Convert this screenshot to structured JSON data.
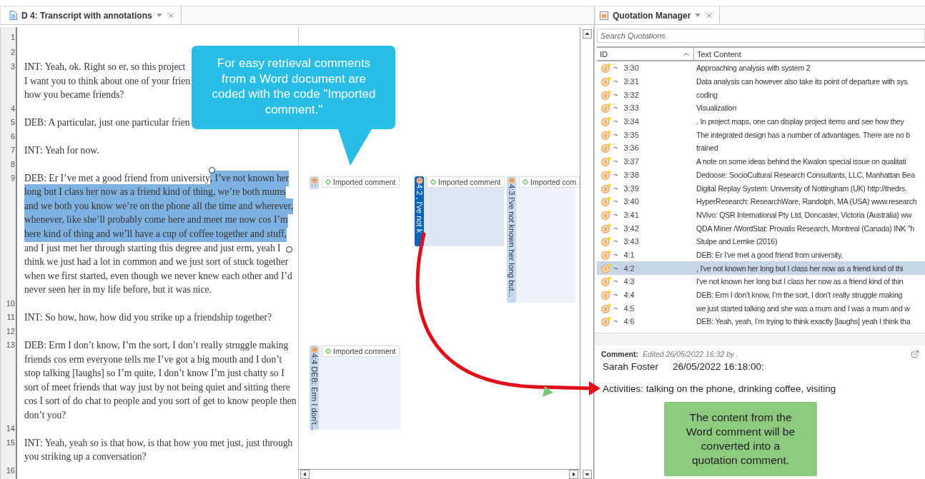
{
  "document_tab": {
    "title": "D 4: Transcript with annotations"
  },
  "transcript": [
    {
      "number": "1"
    },
    {
      "number": "2"
    },
    {
      "number": "3",
      "lines": [
        "INT: Yeah, ok. Right so er, so this project",
        "I want you to think about one of your frien",
        "how you became friends?"
      ]
    },
    {
      "number": "4"
    },
    {
      "number": "5",
      "lines": [
        "DEB: A particular, just one particular frien"
      ]
    },
    {
      "number": "6"
    },
    {
      "number": "7",
      "lines": [
        "INT: Yeah for now."
      ]
    },
    {
      "number": "8"
    },
    {
      "number": "9",
      "lines": [
        [
          {
            "text": "DEB: Er I’ve met a good friend from university",
            "highlighted": false
          },
          {
            "text": ", I’ve not known her",
            "highlighted": true
          }
        ],
        [
          {
            "text": "long but I class her now as a friend kind of thing, we’re both mums",
            "highlighted": true
          }
        ],
        [
          {
            "text": "and we both you know we’re on the phone all the time and wherever,",
            "highlighted": true
          }
        ],
        [
          {
            "text": "whenever, like she’ll probably come here and meet me now cos I’m",
            "highlighted": true
          }
        ],
        [
          {
            "text": "here kind of thing and we’ll have a cup of coffee together and stuff,",
            "highlighted": true
          }
        ],
        "and I just met her through starting this degree and just erm, yeah I",
        "think we just had a lot in common and we just sort of stuck together",
        "when we first started, even though we never knew each other and I’d",
        "never seen her in my life before, but it was nice."
      ]
    },
    {
      "number": "10"
    },
    {
      "number": "11",
      "lines": [
        "INT: So how, how, how did you strike up a friendship together?"
      ]
    },
    {
      "number": "12"
    },
    {
      "number": "13",
      "lines": [
        "DEB: Erm I don’t know, I’m the sort, I don’t really struggle making",
        "friends cos erm everyone tells me I’ve got a big mouth and I don’t",
        "stop talking [laughs] so I’m quite, I don’t know I’m just chatty so I",
        "sort of meet friends that way just by not being quiet and sitting there",
        "cos I sort of do chat to people and you sort of get to know people then",
        "don’t you?"
      ]
    },
    {
      "number": "14"
    },
    {
      "number": "15",
      "lines": [
        "INT: Yeah, yeah so is that how, is that how you met just, just through",
        "you striking up a conversation?"
      ]
    },
    {
      "number": "16"
    }
  ],
  "margin_annotations": [
    {
      "kind": "compact",
      "strip_text": ":",
      "label": "Imported comment",
      "selected": false
    },
    {
      "kind": "card",
      "strip_text": "4:2 , I've not k",
      "label": "Imported comment",
      "selected": true
    },
    {
      "kind": "card",
      "strip_text": "4:3 I've not known her long but...",
      "label": "Imported com",
      "selected": false
    },
    {
      "kind": "card",
      "strip_text": "4:4 DEB: Erm I don't...",
      "label": "Imported comment",
      "selected": false
    }
  ],
  "quotation_manager": {
    "title": "Quotation Manager",
    "search": {
      "placeholder": "Search Quotations"
    },
    "columns": [
      {
        "label": "ID",
        "sorted": true
      },
      {
        "label": "Text Content",
        "sorted": false
      }
    ],
    "rows": [
      {
        "mark": "~",
        "id": "3:30",
        "text": "Approaching analysis with system 2",
        "selected": false
      },
      {
        "mark": "~",
        "id": "3:31",
        "text": "Data analysis can however also take its point of departure with sys",
        "selected": false
      },
      {
        "mark": "~",
        "id": "3:32",
        "text": "coding",
        "selected": false
      },
      {
        "mark": "~",
        "id": "3:33",
        "text": "Visualization",
        "selected": false
      },
      {
        "mark": "~",
        "id": "3:34",
        "text": ". In project maps, one can display project items and see how they",
        "selected": false
      },
      {
        "mark": "~",
        "id": "3:35",
        "text": "The integrated design has a number of advantages. There are no b",
        "selected": false
      },
      {
        "mark": "~",
        "id": "3:36",
        "text": "trained",
        "selected": false
      },
      {
        "mark": "~",
        "id": "3:37",
        "text": "A note on some ideas behind the Kwalon special issue on qualitati",
        "selected": false
      },
      {
        "mark": "~",
        "id": "3:38",
        "text": "Dedoose: SocioCultural Research Consultants, LLC, Manhattan Bea",
        "selected": false
      },
      {
        "mark": "~",
        "id": "3:39",
        "text": "Digital Replay System: University of Nottingham (UK) http://thedrs.",
        "selected": false
      },
      {
        "mark": "~",
        "id": "3:40",
        "text": "HyperResearch: ResearchWare, Randolph, MA (USA) www.research",
        "selected": false
      },
      {
        "mark": "~",
        "id": "3:41",
        "text": "NVivo: QSR International Pty Ltd, Doncaster, Victoria (Australia) ww",
        "selected": false
      },
      {
        "mark": "~",
        "id": "3:42",
        "text": "QDA Miner /WordStat: Provalis Research, Montreal (Canada) INK \"h",
        "selected": false
      },
      {
        "mark": "~",
        "id": "3:43",
        "text": "Stulpe and Lemke (2016)",
        "selected": false
      },
      {
        "mark": "~",
        "id": "4:1",
        "text": "DEB: Er I've met a good friend from university,",
        "selected": false
      },
      {
        "mark": "~",
        "id": "4:2",
        "text": ", I've not known her long but I class her now as a friend kind of thi",
        "selected": true
      },
      {
        "mark": "~",
        "id": "4:3",
        "text": "I've not known her long but I class her now as a friend kind of thin",
        "selected": false
      },
      {
        "mark": "~",
        "id": "4:4",
        "text": "DEB: Erm I don’t know, I’m the sort, I don’t really struggle making",
        "selected": false
      },
      {
        "mark": "~",
        "id": "4:5",
        "text": "we just started talking and she was a mum and I was a mum and w",
        "selected": false
      },
      {
        "mark": "~",
        "id": "4:6",
        "text": "DEB: Yeah, yeah, I’m trying to think exactly [laughs] yeah I think tha",
        "selected": false
      }
    ]
  },
  "comment": {
    "label": "Comment:",
    "edited": "Edited 26/05/2022 16:32 by .",
    "author": "Sarah Foster",
    "timestamp": "26/05/2022 16:18:00:",
    "body": "Activities: talking on the phone, drinking coffee, visiting"
  },
  "callouts": [
    {
      "kind": "speech",
      "text": "For easy retrieval comments from a Word document are coded with the code \"Imported comment.\""
    },
    {
      "kind": "note",
      "text": "The content from the Word comment will be converted into a quotation comment."
    }
  ]
}
